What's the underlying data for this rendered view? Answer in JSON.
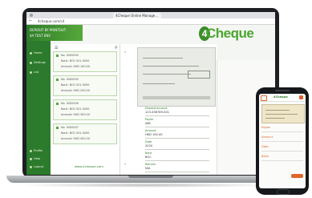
{
  "browser": {
    "tab_label": "4Cheque Online Manage...",
    "address": "4cheque.com/c4",
    "url_short": "· 4· · · ·"
  },
  "app": {
    "brand": "Cheque",
    "brand_prefix": "4",
    "header_lines": [
      "DEPOSIT BY PRINTOUT",
      "4A  TEST ENV"
    ],
    "colors": {
      "green": "#2f7d2b",
      "light_green": "#56a83a"
    }
  },
  "sidebar": {
    "items": [
      {
        "label": "Home"
      },
      {
        "label": "Settings"
      },
      {
        "label": "List"
      },
      {
        "label": "Profile"
      },
      {
        "label": "Help"
      },
      {
        "label": "Logout"
      }
    ]
  },
  "cheque_list": {
    "cards": [
      {
        "line1": "No. 0000004",
        "line2": "Bank: BOC 001-0000",
        "line3": "Amount: HKD 100.00"
      },
      {
        "line1": "No. 0000005",
        "line2": "Bank: BOC 001-0000",
        "line3": "Amount: HKD 200.00"
      },
      {
        "line1": "No. 0000006",
        "line2": "Bank: BOC 001-0000",
        "line3": "Amount: HKD 300.00"
      },
      {
        "line1": "No. 0000007",
        "line2": "Bank: BOC 001-0000",
        "line3": "Amount: HKD 400.00"
      }
    ],
    "footer_link": "www.4cheque.com"
  },
  "detail": {
    "fields": [
      {
        "label": "Deposit Account",
        "value": "123-456789-001"
      },
      {
        "label": "Payee",
        "value": "ABC"
      },
      {
        "label": "Amount",
        "value": "HKD 100.00"
      },
      {
        "label": "Date",
        "value": "2020"
      },
      {
        "label": "Bank",
        "value": "BOC"
      },
      {
        "label": "Remark",
        "value": "N/A"
      }
    ]
  },
  "phone": {
    "title": "4Cheque",
    "rows": [
      "Payee",
      "Amount",
      "Date",
      "Bank"
    ]
  }
}
